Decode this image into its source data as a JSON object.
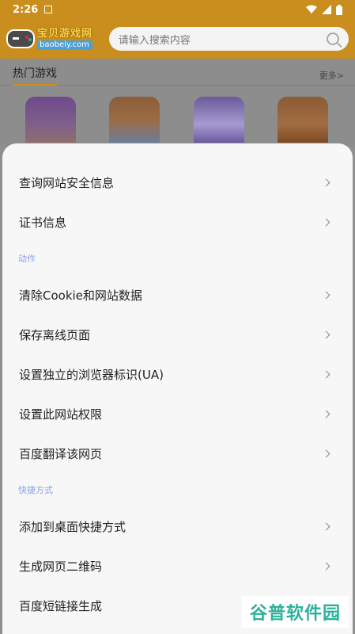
{
  "status_bar": {
    "time": "2:26"
  },
  "header": {
    "logo_cn": "宝贝游戏网",
    "logo_en": "baobeiy.com",
    "search_placeholder": "请输入搜索内容"
  },
  "hot_games": {
    "title": "热门游戏",
    "more": "更多>"
  },
  "menu": {
    "items_top": [
      {
        "label": "查询网站安全信息"
      },
      {
        "label": "证书信息"
      }
    ],
    "section_actions": "动作",
    "items_actions": [
      {
        "label": "清除Cookie和网站数据"
      },
      {
        "label": "保存离线页面"
      },
      {
        "label": "设置独立的浏览器标识(UA)"
      },
      {
        "label": "设置此网站权限"
      },
      {
        "label": "百度翻译该网页"
      }
    ],
    "section_shortcuts": "快捷方式",
    "items_shortcuts": [
      {
        "label": "添加到桌面快捷方式"
      },
      {
        "label": "生成网页二维码"
      },
      {
        "label": "百度短链接生成"
      }
    ]
  },
  "watermark": "谷普软件园"
}
